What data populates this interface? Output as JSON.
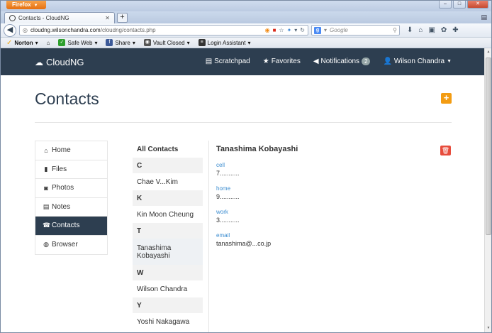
{
  "browser": {
    "app_button": "Firefox",
    "tab_title": "Contacts - CloudNG",
    "url_host": "cloudng.wilsonchandra.com",
    "url_path": "/cloudng/contacts.php",
    "search_placeholder": "Google",
    "toolbar": {
      "norton": "Norton",
      "safe_web": "Safe Web",
      "share": "Share",
      "vault": "Vault Closed",
      "login_assistant": "Login Assistant"
    }
  },
  "app": {
    "brand": "CloudNG",
    "nav": {
      "scratchpad": "Scratchpad",
      "favorites": "Favorites",
      "notifications": "Notifications",
      "notifications_count": "2",
      "user": "Wilson Chandra"
    },
    "page_title": "Contacts",
    "sidebar": [
      {
        "label": "Home",
        "icon": "home-icon"
      },
      {
        "label": "Files",
        "icon": "file-icon"
      },
      {
        "label": "Photos",
        "icon": "camera-icon"
      },
      {
        "label": "Notes",
        "icon": "notes-icon"
      },
      {
        "label": "Contacts",
        "icon": "phone-icon"
      },
      {
        "label": "Browser",
        "icon": "globe-icon"
      }
    ],
    "contacts_header": "All Contacts",
    "contacts": {
      "letter_c": "C",
      "c1": "Chae V...Kim",
      "letter_k": "K",
      "k1": "Kin Moon Cheung",
      "letter_t": "T",
      "t1": "Tanashima Kobayashi",
      "letter_w": "W",
      "w1": "Wilson Chandra",
      "letter_y": "Y",
      "y1": "Yoshi Nakagawa"
    },
    "detail": {
      "name": "Tanashima Kobayashi",
      "cell_label": "cell",
      "cell_value": "7...........",
      "home_label": "home",
      "home_value": "9...........",
      "work_label": "work",
      "work_value": "3...........",
      "email_label": "email",
      "email_value": "tanashima@...co.jp"
    }
  }
}
